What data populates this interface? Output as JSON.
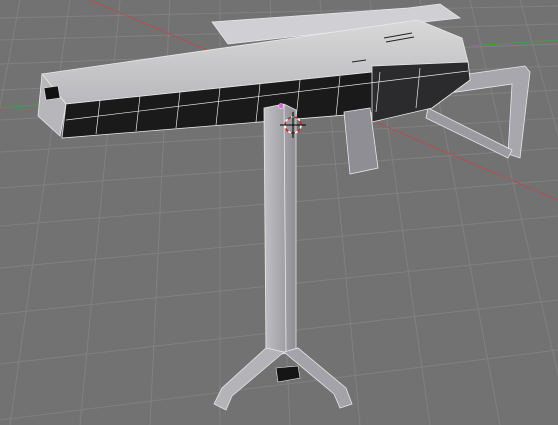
{
  "viewport": {
    "type": "3d-viewport",
    "background_color": "#727272",
    "grid_color": "#7f7f7f",
    "x_axis_color": "#b25050",
    "y_axis_color": "#4a9a4a",
    "wireframe_color": "#e8e8e8",
    "cursor_icon": "3d-cursor-icon"
  },
  "objects": [
    {
      "name": "gun-model"
    },
    {
      "name": "stand-model"
    }
  ]
}
